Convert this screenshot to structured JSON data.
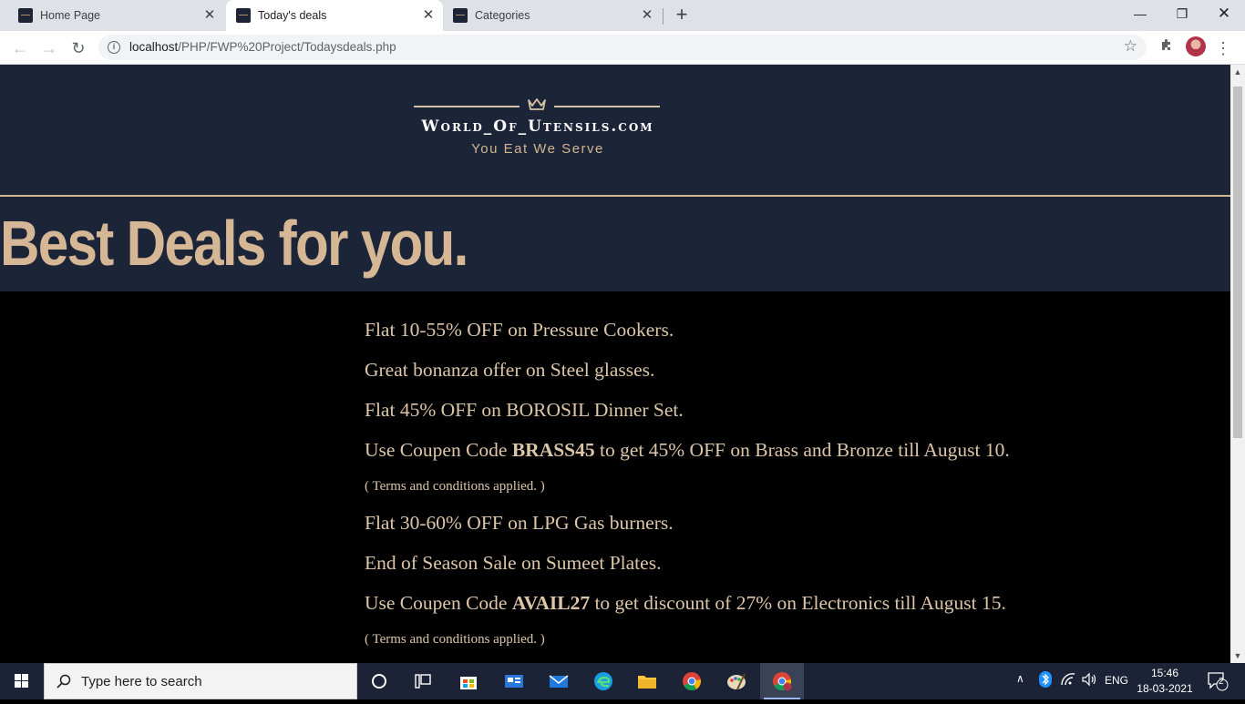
{
  "browser": {
    "tabs": [
      {
        "label": "Home Page"
      },
      {
        "label": "Today's deals"
      },
      {
        "label": "Categories"
      }
    ],
    "new_tab_label": "+",
    "url_host": "localhost",
    "url_path": "/PHP/FWP%20Project/Todaysdeals.php"
  },
  "page": {
    "brand": "World_Of_Utensils.com",
    "tagline": "You Eat We Serve",
    "headline": "Best Deals for you.",
    "deals": [
      {
        "before": "Flat 10-55% OFF on Pressure Cookers.",
        "code": "",
        "after": ""
      },
      {
        "before": "Great bonanza offer on Steel glasses.",
        "code": "",
        "after": ""
      },
      {
        "before": "Flat 45% OFF on BOROSIL Dinner Set.",
        "code": "",
        "after": ""
      },
      {
        "before": "Use Coupen Code ",
        "code": "BRASS45",
        "after": " to get 45% OFF on Brass and Bronze till August 10."
      },
      {
        "before": "Flat 30-60% OFF on LPG Gas burners.",
        "code": "",
        "after": ""
      },
      {
        "before": "End of Season Sale on Sumeet Plates.",
        "code": "",
        "after": ""
      },
      {
        "before": "Use Coupen Code ",
        "code": "AVAIL27",
        "after": " to get discount of 27% on Electronics till August 15."
      }
    ],
    "terms_note": "( Terms and conditions applied. )",
    "colors": {
      "header_bg": "#1c2438",
      "accent": "#d6b795",
      "body_bg": "#000000"
    }
  },
  "taskbar": {
    "search_placeholder": "Type here to search",
    "language": "ENG",
    "time": "15:46",
    "date": "18-03-2021",
    "notification_count": "2"
  }
}
